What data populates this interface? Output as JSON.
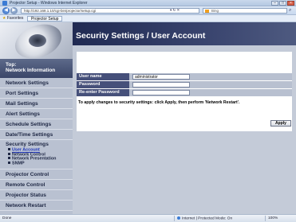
{
  "browser": {
    "window_title": "Projector Setup - Windows Internet Explorer",
    "window_buttons": {
      "minimize": "–",
      "maximize": "□",
      "close": "×"
    },
    "address": "http://192.168.1.10/cgi-bin/projector/setup.cgi",
    "address_tools": "▾ ↻ ✕",
    "search_placeholder": "Bing",
    "favorites_label": "Favorites",
    "tab_label": "Projector Setup",
    "status_left": "Done",
    "status_zone": "Internet | Protected Mode: On",
    "status_zoom": "100%"
  },
  "sidebar": {
    "top_label": "Top:",
    "top_title": "Network Information",
    "items_before": [
      "Network Settings",
      "Port Settings",
      "Mail Settings",
      "Alert Settings",
      "Schedule Settings",
      "Date/Time Settings"
    ],
    "security": {
      "heading": "Security Settings",
      "subitems": [
        "User Account",
        "Network Control",
        "Network Presentation",
        "SNMP"
      ]
    },
    "items_after": [
      "Projector Control",
      "Remote Control",
      "Projector Status",
      "Network Restart"
    ]
  },
  "main": {
    "title": "Security Settings / User Account",
    "fields": [
      {
        "label": "User name",
        "value": "administrator"
      },
      {
        "label": "Password",
        "value": ""
      },
      {
        "label": "Re-enter Password",
        "value": ""
      }
    ],
    "note": "To apply changes to security settings: click Apply, then perform 'Network Restart'.",
    "apply_label": "Apply"
  }
}
